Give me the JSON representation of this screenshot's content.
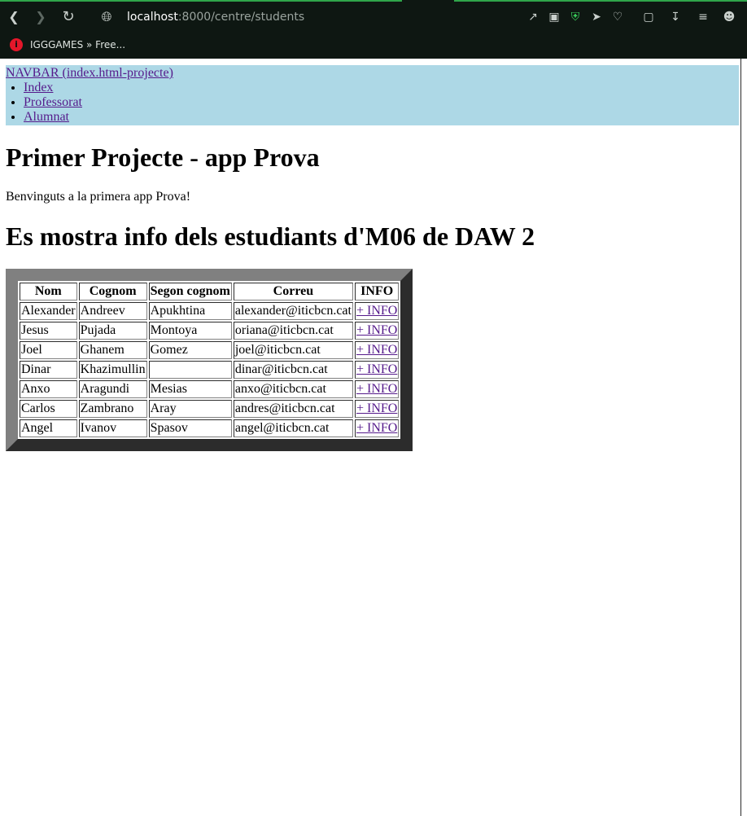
{
  "browser": {
    "url_host": "localhost",
    "url_path": ":8000/centre/students",
    "bookmark_label": "IGGGAMES » Free..."
  },
  "navbar": {
    "title": "NAVBAR (index.html-projecte)",
    "links": [
      "Index",
      "Professorat",
      "Alumnat"
    ]
  },
  "page": {
    "heading": "Primer Projecte - app Prova",
    "welcome": "Benvinguts a la primera app Prova!",
    "subheading": "Es mostra info dels estudiants d'M06 de DAW 2"
  },
  "table": {
    "headers": [
      "Nom",
      "Cognom",
      "Segon cognom",
      "Correu",
      "INFO"
    ],
    "link_text": "+ INFO",
    "rows": [
      [
        "Alexander",
        "Andreev",
        "Apukhtina",
        "alexander@iticbcn.cat"
      ],
      [
        "Jesus",
        "Pujada",
        "Montoya",
        "oriana@iticbcn.cat"
      ],
      [
        "Joel",
        "Ghanem",
        "Gomez",
        "joel@iticbcn.cat"
      ],
      [
        "Dinar",
        "Khazimullin",
        "",
        "dinar@iticbcn.cat"
      ],
      [
        "Anxo",
        "Aragundi",
        "Mesias",
        "anxo@iticbcn.cat"
      ],
      [
        "Carlos",
        "Zambrano",
        "Aray",
        "andres@iticbcn.cat"
      ],
      [
        "Angel",
        "Ivanov",
        "Spasov",
        "angel@iticbcn.cat"
      ]
    ]
  },
  "colors": {
    "navbar_bg": "#add8e6",
    "visited_link": "#551a8b",
    "table_border": "#808080",
    "browser_accent": "#2fa54a"
  }
}
